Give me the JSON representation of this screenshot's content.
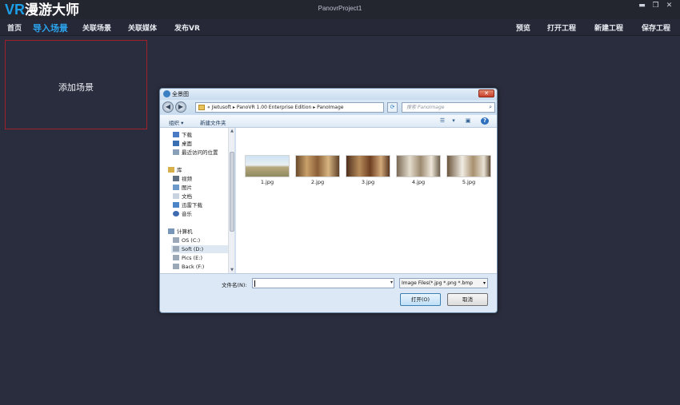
{
  "app": {
    "logo_vr": "VR",
    "logo_rest": "漫游大师",
    "project_title": "PanovrProject1"
  },
  "window_controls": {
    "minimize": "▬",
    "restore": "❐",
    "close": "✕"
  },
  "menu": {
    "home": "首页",
    "import_scene": "导入场景",
    "link_scene": "关联场景",
    "link_media": "关联媒体",
    "publish_vr": "发布VR",
    "preview": "预览",
    "open_project": "打开工程",
    "new_project": "新建工程",
    "save_project": "保存工程"
  },
  "scene_panel": {
    "add_scene_label": "添加场景"
  },
  "dialog": {
    "title": "全景图",
    "address_path": "« Jietusoft ▸ PanoVR 1.00 Enterprise Edition ▸ PanoImage",
    "search_placeholder": "搜索 PanoImage",
    "toolbar": {
      "organize": "组织 ▾",
      "new_folder": "新建文件夹"
    },
    "tree": {
      "downloads": "下载",
      "desktop": "桌面",
      "recent": "最近访问的位置",
      "libraries": "库",
      "videos": "视频",
      "pictures": "图片",
      "documents": "文档",
      "thunder": "迅雷下载",
      "music": "音乐",
      "computer": "计算机",
      "drive_c": "OS (C:)",
      "drive_d": "Soft (D:)",
      "drive_e": "Pics (E:)",
      "drive_f": "Back (F:)"
    },
    "files": [
      {
        "name": "1.jpg"
      },
      {
        "name": "2.jpg"
      },
      {
        "name": "3.jpg"
      },
      {
        "name": "4.jpg"
      },
      {
        "name": "5.jpg"
      }
    ],
    "filename_label": "文件名(N):",
    "filename_value": "",
    "filetype_value": "Image Files(*.jpg *.png *.bmp",
    "open_button": "打开(O)",
    "cancel_button": "取消"
  },
  "colors": {
    "background": "#2a2d3d",
    "accent": "#2aa4ef",
    "scene_border": "#a1212b"
  }
}
